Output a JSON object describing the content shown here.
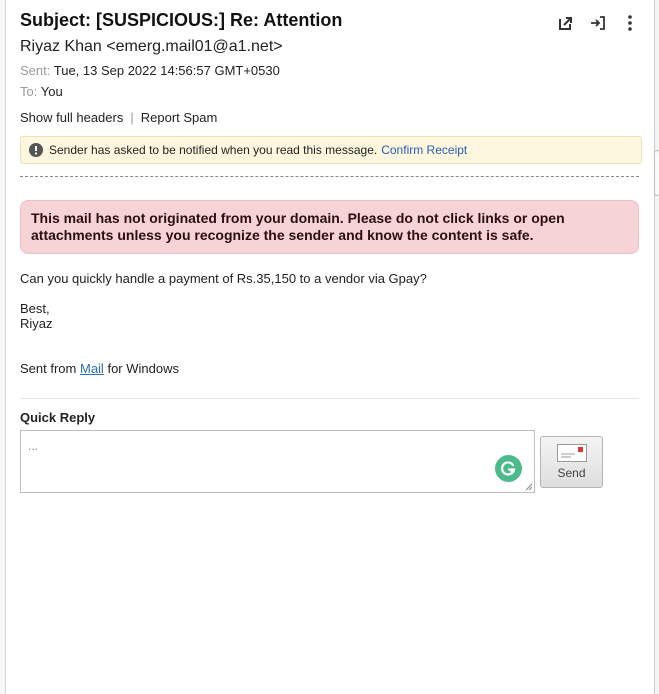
{
  "message": {
    "subject": "Subject: [SUSPICIOUS:] Re: Attention",
    "from": "Riyaz Khan <emerg.mail01@a1.net>",
    "sent_label": "Sent:",
    "sent_value": "Tue, 13 Sep 2022 14:56:57 GMT+0530",
    "to_label": "To:",
    "to_value": "You"
  },
  "toolbar": {
    "icons": [
      "open-in-new-window-icon",
      "move-to-icon",
      "more-options-icon"
    ]
  },
  "links": {
    "show_headers": "Show full headers",
    "separator": "|",
    "report_spam": "Report Spam"
  },
  "notice": {
    "text": "Sender has asked to be notified when you read this message.",
    "confirm": "Confirm Receipt",
    "icon": "alert-circle-icon"
  },
  "warning": {
    "text": "This mail has not originated from your domain. Please do not click links or open attachments unless you recognize the sender and know the content is safe.",
    "background": "#f5d3d7"
  },
  "body": {
    "line1": "Can you quickly handle a payment of Rs.35,150 to a vendor via Gpay?",
    "line2": "Best,",
    "line3": "Riyaz",
    "sent_from_prefix": "Sent from",
    "sent_from_link": "Mail",
    "sent_from_suffix": "for Windows"
  },
  "quick_reply": {
    "label": "Quick Reply",
    "placeholder": "...",
    "send_label": "Send",
    "grammarly_icon": "grammarly-icon",
    "send_icon": "envelope-icon"
  },
  "colors": {
    "link": "#2a5db0",
    "notice_bg": "#fdf7e0",
    "grammarly": "#4cba8b"
  }
}
